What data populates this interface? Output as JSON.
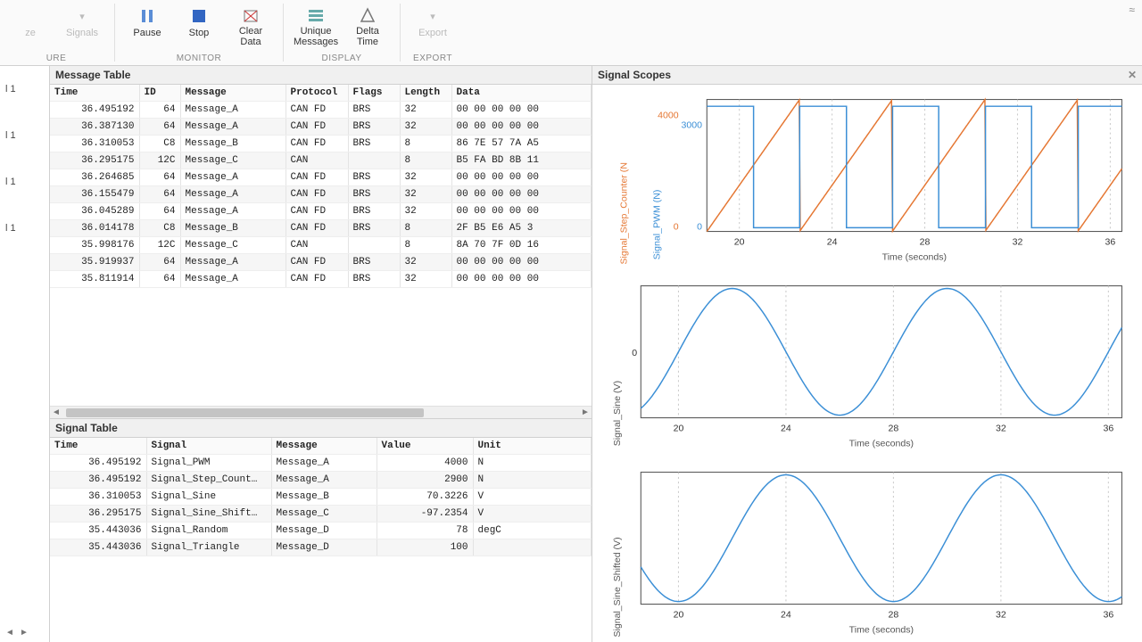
{
  "ribbon": {
    "groups": {
      "configure_label": "URE",
      "monitor_label": "MONITOR",
      "display_label": "DISPLAY",
      "export_label": "EXPORT"
    },
    "signals": "Signals",
    "pause": "Pause",
    "stop": "Stop",
    "clear": "Clear\nData",
    "unique": "Unique\nMessages",
    "delta": "Delta\nTime",
    "export": "Export"
  },
  "sidebar": {
    "items": [
      "l 1",
      "l 1",
      "l 1",
      "l 1"
    ]
  },
  "panels": {
    "message_table": "Message Table",
    "signal_table": "Signal Table",
    "signal_scopes": "Signal Scopes"
  },
  "msg_headers": [
    "Time",
    "ID",
    "Message",
    "Protocol",
    "Flags",
    "Length",
    "Data"
  ],
  "msg_rows": [
    {
      "time": "36.495192",
      "id": "64",
      "msg": "Message_A",
      "proto": "CAN FD",
      "flags": "BRS",
      "len": "32",
      "data": "00 00 00 00 00"
    },
    {
      "time": "36.387130",
      "id": "64",
      "msg": "Message_A",
      "proto": "CAN FD",
      "flags": "BRS",
      "len": "32",
      "data": "00 00 00 00 00"
    },
    {
      "time": "36.310053",
      "id": "C8",
      "msg": "Message_B",
      "proto": "CAN FD",
      "flags": "BRS",
      "len": "8",
      "data": "86 7E 57 7A A5"
    },
    {
      "time": "36.295175",
      "id": "12C",
      "msg": "Message_C",
      "proto": "CAN",
      "flags": "",
      "len": "8",
      "data": "B5 FA BD 8B 11"
    },
    {
      "time": "36.264685",
      "id": "64",
      "msg": "Message_A",
      "proto": "CAN FD",
      "flags": "BRS",
      "len": "32",
      "data": "00 00 00 00 00"
    },
    {
      "time": "36.155479",
      "id": "64",
      "msg": "Message_A",
      "proto": "CAN FD",
      "flags": "BRS",
      "len": "32",
      "data": "00 00 00 00 00"
    },
    {
      "time": "36.045289",
      "id": "64",
      "msg": "Message_A",
      "proto": "CAN FD",
      "flags": "BRS",
      "len": "32",
      "data": "00 00 00 00 00"
    },
    {
      "time": "36.014178",
      "id": "C8",
      "msg": "Message_B",
      "proto": "CAN FD",
      "flags": "BRS",
      "len": "8",
      "data": "2F B5 E6 A5 3"
    },
    {
      "time": "35.998176",
      "id": "12C",
      "msg": "Message_C",
      "proto": "CAN",
      "flags": "",
      "len": "8",
      "data": "8A 70 7F 0D 16"
    },
    {
      "time": "35.919937",
      "id": "64",
      "msg": "Message_A",
      "proto": "CAN FD",
      "flags": "BRS",
      "len": "32",
      "data": "00 00 00 00 00"
    },
    {
      "time": "35.811914",
      "id": "64",
      "msg": "Message_A",
      "proto": "CAN FD",
      "flags": "BRS",
      "len": "32",
      "data": "00 00 00 00 00"
    }
  ],
  "sig_headers": [
    "Time",
    "Signal",
    "Message",
    "Value",
    "Unit"
  ],
  "sig_rows": [
    {
      "time": "36.495192",
      "signal": "Signal_PWM",
      "msg": "Message_A",
      "val": "4000",
      "unit": "N"
    },
    {
      "time": "36.495192",
      "signal": "Signal_Step_Count…",
      "msg": "Message_A",
      "val": "2900",
      "unit": "N"
    },
    {
      "time": "36.310053",
      "signal": "Signal_Sine",
      "msg": "Message_B",
      "val": "70.3226",
      "unit": "V"
    },
    {
      "time": "36.295175",
      "signal": "Signal_Sine_Shift…",
      "msg": "Message_C",
      "val": "-97.2354",
      "unit": "V"
    },
    {
      "time": "35.443036",
      "signal": "Signal_Random",
      "msg": "Message_D",
      "val": "78",
      "unit": "degC"
    },
    {
      "time": "35.443036",
      "signal": "Signal_Triangle",
      "msg": "Message_D",
      "val": "100",
      "unit": ""
    }
  ],
  "chart_data": [
    {
      "type": "line",
      "xlabel": "Time (seconds)",
      "ylabel_left": "Signal_Step_Counter (N",
      "ylabel_right": "Signal_PWM (N)",
      "xlim": [
        18.6,
        36.5
      ],
      "x_ticks": [
        20,
        24,
        28,
        32,
        36
      ],
      "y_ticks_left": [
        0,
        4000
      ],
      "y_ticks_right": [
        0,
        3000
      ],
      "series": [
        {
          "name": "Signal_Step_Counter",
          "color": "#e57733",
          "sawtooth_period": 4.0,
          "sawtooth_min": 0,
          "sawtooth_max": 4000
        },
        {
          "name": "Signal_PWM",
          "color": "#3b8fd6",
          "square_period": 4.0,
          "low": 0,
          "high": 3000,
          "duty": 0.5
        }
      ]
    },
    {
      "type": "line",
      "xlabel": "Time (seconds)",
      "ylabel": "Signal_Sine (V)",
      "xlim": [
        18.6,
        36.5
      ],
      "x_ticks": [
        20,
        24,
        28,
        32,
        36
      ],
      "y_ticks": [
        0
      ],
      "series": [
        {
          "name": "Signal_Sine",
          "color": "#3b8fd6",
          "sine_period": 8.0,
          "amp": 100,
          "phase_at_x0": 0
        }
      ]
    },
    {
      "type": "line",
      "xlabel": "Time (seconds)",
      "ylabel": "Signal_Sine_Shifted (V)",
      "xlim": [
        18.6,
        36.5
      ],
      "x_ticks": [
        20,
        24,
        28,
        32,
        36
      ],
      "y_ticks": [],
      "series": [
        {
          "name": "Signal_Sine_Shifted",
          "color": "#3b8fd6",
          "sine_period": 8.0,
          "amp": 100,
          "phase_shift": 2.0
        }
      ]
    }
  ]
}
